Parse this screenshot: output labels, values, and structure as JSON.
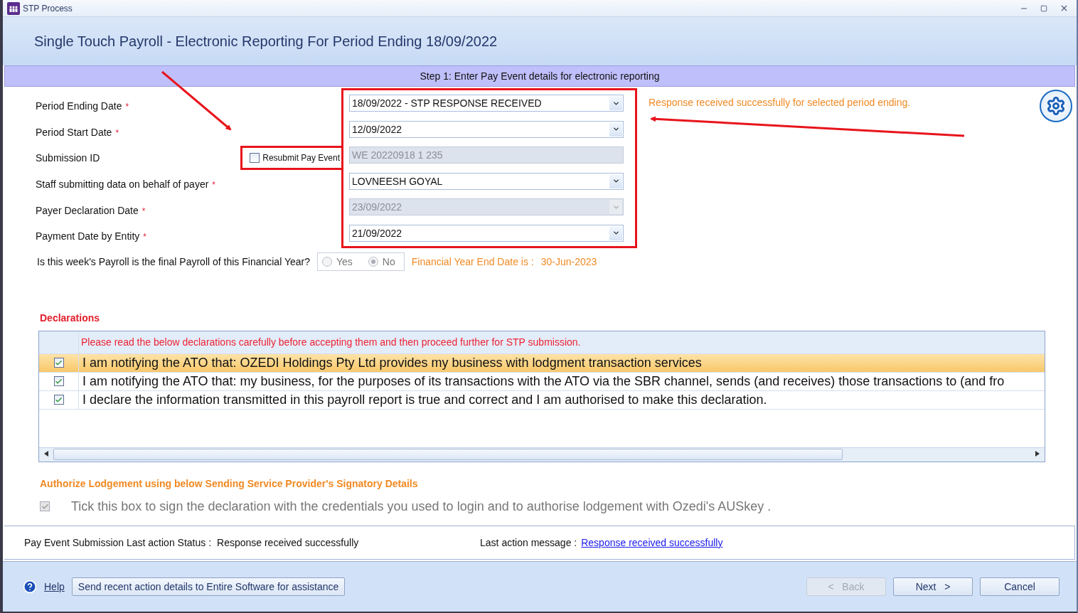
{
  "window": {
    "title": "STP Process"
  },
  "header": {
    "title": "Single Touch Payroll - Electronic Reporting For Period Ending 18/09/2022"
  },
  "step": {
    "label": "Step 1: Enter Pay Event details for electronic reporting"
  },
  "fields": [
    {
      "label": "Period Ending Date",
      "required_mark": "*",
      "kind": "dropdown",
      "value": "18/09/2022 - STP RESPONSE RECEIVED",
      "disabled": false
    },
    {
      "label": "Period Start Date",
      "required_mark": "*",
      "kind": "dropdown",
      "value": "12/09/2022",
      "disabled": false
    },
    {
      "label": "Submission ID",
      "kind": "text",
      "value": "WE  20220918  1  235",
      "disabled": true
    },
    {
      "label": "Staff submitting data on behalf of payer",
      "required_mark": "*",
      "kind": "dropdown",
      "value": "LOVNEESH GOYAL",
      "disabled": false
    },
    {
      "label": "Payer Declaration Date",
      "required_mark": "*",
      "kind": "dropdown",
      "value": "23/09/2022",
      "disabled": true
    },
    {
      "label": "Payment Date by Entity",
      "required_mark": "*",
      "kind": "dropdown",
      "value": "21/09/2022",
      "disabled": false
    }
  ],
  "resubmit": {
    "label": "Resubmit Pay Event",
    "checked": false
  },
  "response_message": "Response received successfully for selected period ending.",
  "final_payroll": {
    "question": "Is this week's Payroll is the final Payroll of this Financial Year?",
    "disabled": true,
    "options": [
      {
        "label": "Yes",
        "selected": false
      },
      {
        "label": "No",
        "selected": true
      }
    ]
  },
  "financial_year_end": {
    "label": "Financial Year End Date is :",
    "value": "30-Jun-2023"
  },
  "declarations": {
    "title": "Declarations",
    "header": "Please read the below declarations carefully before accepting them and then proceed further for STP submission.",
    "rows": [
      {
        "text": "I am notifying the ATO that: OZEDI Holdings Pty Ltd provides my business with lodgment transaction services",
        "checked": true,
        "selected": true
      },
      {
        "text": "I am notifying the ATO that: my business, for the purposes of its transactions with the ATO via the SBR channel, sends (and receives) those transactions to (and fro",
        "checked": true,
        "selected": false
      },
      {
        "text": "I declare the information transmitted in this payroll report is true and correct and I am authorised to make this declaration.",
        "checked": true,
        "selected": false
      }
    ]
  },
  "authorize": {
    "title": "Authorize Lodgement using below Sending Service Provider's Signatory Details",
    "label": "Tick this box to sign the declaration with the credentials you used to login and to authorise lodgement with Ozedi's AUSkey .",
    "checked": true,
    "disabled": true
  },
  "status": {
    "label": "Pay Event Submission Last action Status :",
    "value": "Response received successfully",
    "message_label": "Last action message :",
    "message_link": "Response received successfully"
  },
  "footer": {
    "help": "Help",
    "send_button": "Send recent action details to Entire Software for assistance",
    "buttons": [
      {
        "label": "<   Back",
        "disabled": true
      },
      {
        "label": "Next   >",
        "disabled": false
      },
      {
        "label": "Cancel",
        "disabled": false
      }
    ]
  }
}
